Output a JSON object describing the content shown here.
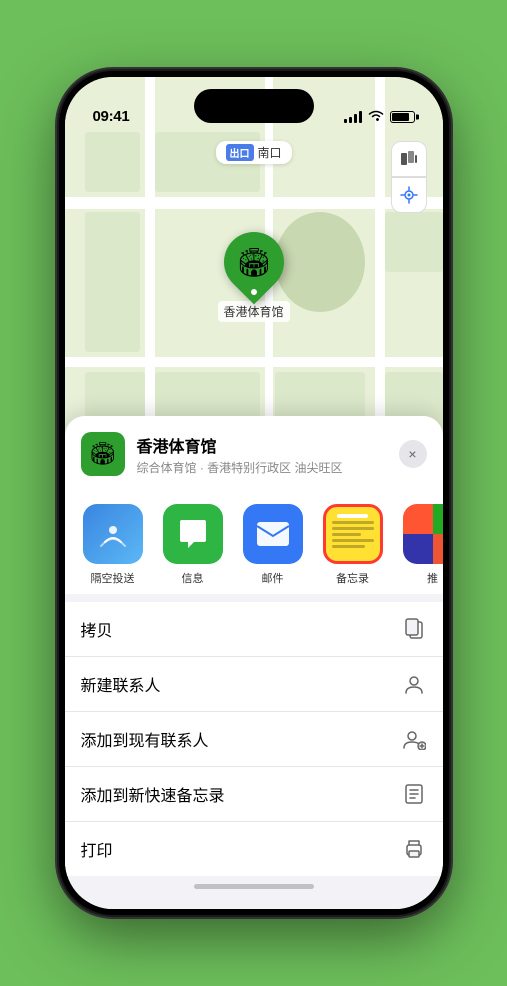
{
  "phone": {
    "time": "09:41",
    "status_icons": {
      "signal": 4,
      "wifi": true,
      "battery": 85
    }
  },
  "map": {
    "location_tag": "出口",
    "location_label": "南口",
    "controls": {
      "map_type": "🗺",
      "location": "➤"
    }
  },
  "venue": {
    "name": "香港体育馆",
    "description": "综合体育馆 · 香港特别行政区 油尖旺区",
    "icon": "🏟"
  },
  "share_actions": [
    {
      "id": "airdrop",
      "label": "隔空投送",
      "type": "airdrop"
    },
    {
      "id": "messages",
      "label": "信息",
      "type": "messages"
    },
    {
      "id": "mail",
      "label": "邮件",
      "type": "mail"
    },
    {
      "id": "notes",
      "label": "备忘录",
      "type": "notes"
    },
    {
      "id": "more",
      "label": "推",
      "type": "more"
    }
  ],
  "actions": [
    {
      "id": "copy",
      "label": "拷贝",
      "icon": "copy"
    },
    {
      "id": "new-contact",
      "label": "新建联系人",
      "icon": "person"
    },
    {
      "id": "add-existing",
      "label": "添加到现有联系人",
      "icon": "person-add"
    },
    {
      "id": "add-notes",
      "label": "添加到新快速备忘录",
      "icon": "note"
    },
    {
      "id": "print",
      "label": "打印",
      "icon": "print"
    }
  ],
  "labels": {
    "close": "×"
  }
}
